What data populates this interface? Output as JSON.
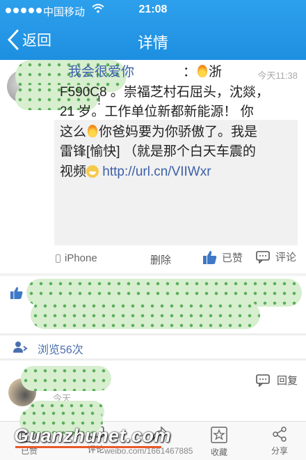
{
  "status_bar": {
    "carrier": "中国移动",
    "time": "21:08"
  },
  "nav": {
    "back_label": "返回",
    "title": "详情"
  },
  "post": {
    "timestamp": "今天11:38",
    "author_trailing": "!",
    "quote": {
      "nickname": "我会很爱你",
      "colon": "：",
      "line1_after_fire": "浙",
      "line2": "F590C8 。崇福芝村石屈头，沈燚，",
      "line3": "21 岁。工作单位新都新能源！ 你",
      "line4a": "这么",
      "line4b": "你爸妈要为你骄傲了。我是",
      "line5": "雷锋[愉快]  （就是那个白天车震的",
      "line6a": "视频",
      "link": "http://url.cn/VIIWxr"
    },
    "device": "iPhone",
    "delete_label": "删除",
    "liked_label": "已赞",
    "comment_label": "评论"
  },
  "views": {
    "label": "浏览56次"
  },
  "comment": {
    "time_prefix": "今天",
    "reply_label": "回复"
  },
  "toolbar": {
    "items": [
      {
        "label": "已赞",
        "icon": "thumb-icon"
      },
      {
        "label": "评论",
        "icon": "comment-icon"
      },
      {
        "label": "",
        "icon": "share-arrow-icon"
      },
      {
        "label": "收藏",
        "icon": "star-icon"
      },
      {
        "label": "分享",
        "icon": "share-icon"
      }
    ]
  },
  "watermark": {
    "site": "Guanzhunet.com",
    "weibo": "weibo.com/1661467885"
  },
  "colors": {
    "nav_blue": "#1e8fe0",
    "link_blue": "#3b5fa7",
    "redaction_green": "#d7eecf",
    "watermark_orange": "#e8592a"
  }
}
